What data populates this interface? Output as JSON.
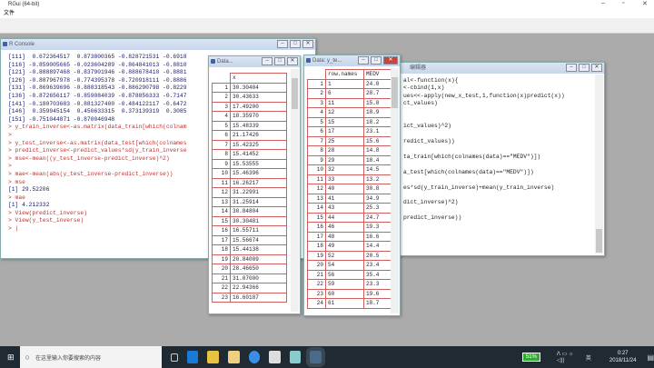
{
  "app": {
    "title": "RGui (64-bit)",
    "menu": [
      "文件"
    ]
  },
  "console": {
    "title": "R Console",
    "lines": [
      {
        "t": "[111]  0.672364517  0.873800365 -0.828721531 -0.6918",
        "in": false
      },
      {
        "t": "[116] -0.859005665 -0.023604289 -0.864841013 -0.8810",
        "in": false
      },
      {
        "t": "[121] -0.888897468 -0.837901946 -0.888678410 -0.8881",
        "in": false
      },
      {
        "t": "[126] -0.887967978 -0.774395378 -0.720918111 -0.8886",
        "in": false
      },
      {
        "t": "[131] -0.869639696 -0.888318543 -0.886290798 -0.8229",
        "in": false
      },
      {
        "t": "[136] -0.872656117 -0.859084039 -0.878856333 -0.7147",
        "in": false
      },
      {
        "t": "[141] -0.180703683 -0.881327400 -0.484122117 -0.6472",
        "in": false
      },
      {
        "t": "[146]  0.359945154  0.450633315  0.373139319  0.3085",
        "in": false
      },
      {
        "t": "[151] -0.751044871 -0.870046948",
        "in": false
      },
      {
        "t": "> y_train_inverse<-as.matrix(data_train[which(colnam",
        "in": true
      },
      {
        "t": ">",
        "in": true
      },
      {
        "t": "> y_test_inverse<-as.matrix(data_test[which(colnames",
        "in": true
      },
      {
        "t": "> predict_inverse<-predict_values*sd(y_train_inverse",
        "in": true
      },
      {
        "t": "> mse<-mean((y_test_inverse-predict_inverse)^2)",
        "in": true
      },
      {
        "t": ">",
        "in": true
      },
      {
        "t": "> mae<-mean(abs(y_test_inverse-predict_inverse))",
        "in": true
      },
      {
        "t": "> mse",
        "in": true
      },
      {
        "t": "[1] 29.52206",
        "in": false
      },
      {
        "t": "> mae",
        "in": true
      },
      {
        "t": "[1] 4.212332",
        "in": false
      },
      {
        "t": "> View(predict_inverse)",
        "in": true
      },
      {
        "t": "> View(y_test_inverse)",
        "in": true
      },
      {
        "t": "> |",
        "in": true
      }
    ]
  },
  "editor": {
    "title": "编辑器",
    "lines": [
      "al<-function(x){",
      "<-cbind(1,x)",
      "ues<<-apply(new_x_test,1,function(x)predict(x))",
      "ct_values)",
      "",
      "",
      "ict_values)^2)",
      "",
      "redict_values))",
      "",
      "ta_train[which(colnames(data)==\"MEDV\")])",
      "",
      "a_test[which(colnames(data)==\"MEDV\")])",
      "",
      "es*sd(y_train_inverse)+mean(y_train_inverse)",
      "",
      "dict_inverse)^2)",
      "",
      "predict_inverse))"
    ]
  },
  "view1": {
    "title": "Data...",
    "header": "x",
    "rows": [
      "30.30404",
      "30.43633",
      "17.49200",
      "18.35970",
      "15.48339",
      "21.17426",
      "15.42325",
      "15.41452",
      "15.53555",
      "15.46396",
      "16.26217",
      "31.22991",
      "31.25914",
      "30.84804",
      "30.30481",
      "16.55711",
      "15.56674",
      "15.44138",
      "20.84009",
      "28.46650",
      "31.07000",
      "22.94366",
      "16.60187"
    ]
  },
  "view2": {
    "title": "Data: y_te...",
    "headers": [
      "row.names",
      "MEDV"
    ],
    "rows": [
      [
        "1",
        "24.0"
      ],
      [
        "6",
        "28.7"
      ],
      [
        "11",
        "15.0"
      ],
      [
        "12",
        "18.9"
      ],
      [
        "15",
        "18.2"
      ],
      [
        "17",
        "23.1"
      ],
      [
        "25",
        "15.6"
      ],
      [
        "28",
        "14.8"
      ],
      [
        "29",
        "18.4"
      ],
      [
        "32",
        "14.5"
      ],
      [
        "33",
        "13.2"
      ],
      [
        "40",
        "30.8"
      ],
      [
        "41",
        "34.9"
      ],
      [
        "43",
        "25.3"
      ],
      [
        "44",
        "24.7"
      ],
      [
        "46",
        "19.3"
      ],
      [
        "48",
        "16.6"
      ],
      [
        "49",
        "14.4"
      ],
      [
        "52",
        "20.5"
      ],
      [
        "54",
        "23.4"
      ],
      [
        "56",
        "35.4"
      ],
      [
        "59",
        "23.3"
      ],
      [
        "60",
        "19.6"
      ],
      [
        "61",
        "18.7"
      ]
    ]
  },
  "taskbar": {
    "search_placeholder": "在这里输入你要搜索的内容",
    "battery": "51%",
    "time": "0:27",
    "date": "2018/11/24",
    "ime": "英"
  }
}
